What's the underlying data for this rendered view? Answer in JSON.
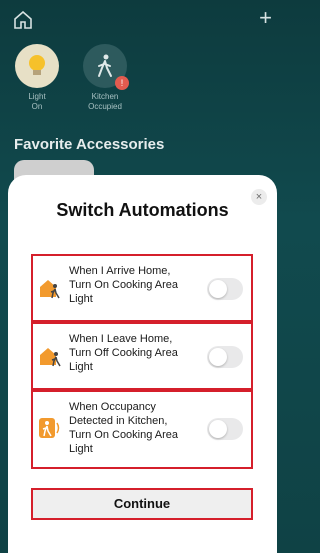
{
  "background": {
    "status_items": [
      {
        "label": "Light\nOn",
        "icon": "lightbulb-icon"
      },
      {
        "label": "Kitchen\nOccupied",
        "icon": "person-walking-icon",
        "badge": "!"
      }
    ],
    "section_title": "Favorite Accessories"
  },
  "sheet": {
    "title": "Switch Automations",
    "close_label": "×",
    "rows": [
      {
        "text": "When I Arrive Home,\nTurn On Cooking Area\nLight",
        "icon": "house-arrive-icon",
        "toggle_on": false
      },
      {
        "text": "When I Leave Home,\nTurn Off Cooking Area\nLight",
        "icon": "house-leave-icon",
        "toggle_on": false
      },
      {
        "text": "When Occupancy\nDetected in Kitchen,\nTurn On Cooking Area\nLight",
        "icon": "occupancy-sensor-icon",
        "toggle_on": false
      }
    ],
    "continue_label": "Continue"
  },
  "colors": {
    "highlight_border": "#d51f2b",
    "house_icon": "#f29a2e",
    "toggle_off": "#e9e9ea"
  }
}
